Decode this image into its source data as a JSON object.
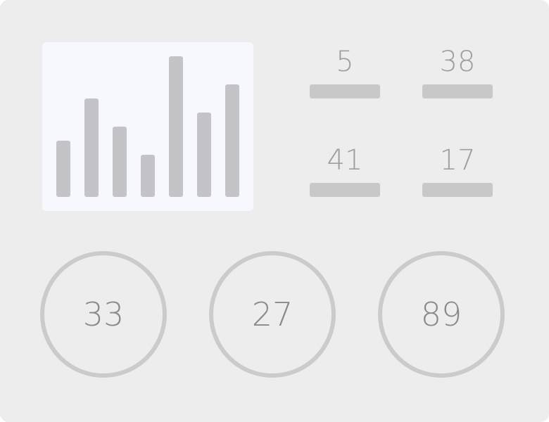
{
  "colors": {
    "panel": "#ededed",
    "chart_card": "#f7f8fe",
    "chart_bar": "#c4c4c8",
    "stat_bar": "#c8c8c9",
    "gauge_ring": "#cbcbcb"
  },
  "chart_data": {
    "type": "bar",
    "values": [
      4,
      7,
      5,
      3,
      10,
      6,
      8
    ],
    "ylim": [
      0,
      10
    ],
    "title": "",
    "xlabel": "",
    "ylabel": ""
  },
  "stats": [
    {
      "value": "5"
    },
    {
      "value": "38"
    },
    {
      "value": "41"
    },
    {
      "value": "17"
    }
  ],
  "gauges": [
    {
      "value": "33"
    },
    {
      "value": "27"
    },
    {
      "value": "89"
    }
  ]
}
